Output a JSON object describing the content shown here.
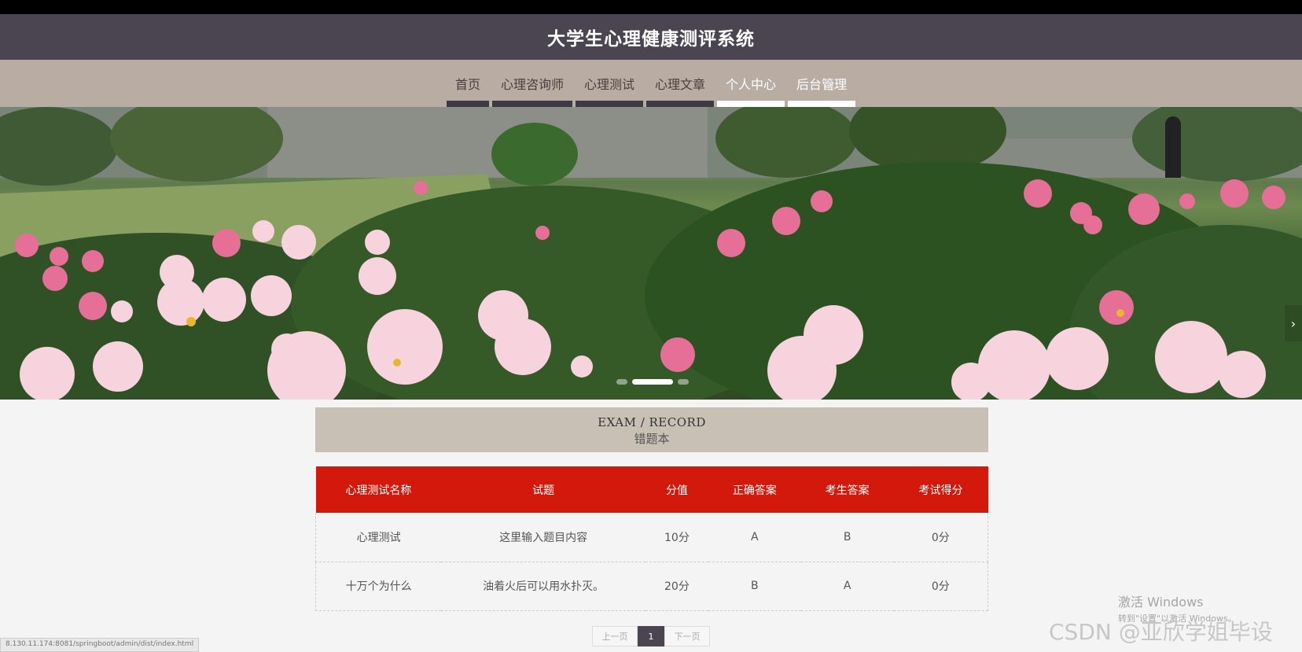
{
  "site": {
    "title": "大学生心理健康测评系统"
  },
  "nav": {
    "items": [
      {
        "label": "首页"
      },
      {
        "label": "心理咨询师"
      },
      {
        "label": "心理测试"
      },
      {
        "label": "心理文章"
      },
      {
        "label": "个人中心"
      },
      {
        "label": "后台管理"
      }
    ]
  },
  "carousel": {
    "next_glyph": "›",
    "active_slide": 2,
    "slide_count": 3
  },
  "section": {
    "title_en": "EXAM / RECORD",
    "title_cn": "错题本"
  },
  "table": {
    "columns": [
      "心理测试名称",
      "试题",
      "分值",
      "正确答案",
      "考生答案",
      "考试得分"
    ],
    "rows": [
      [
        "心理测试",
        "这里输入题目内容",
        "10分",
        "A",
        "B",
        "0分"
      ],
      [
        "十万个为什么",
        "油着火后可以用水扑灭。",
        "20分",
        "B",
        "A",
        "0分"
      ]
    ]
  },
  "pagination": {
    "prev": "上一页",
    "current": "1",
    "next": "下一页"
  },
  "overlay": {
    "windows_activate": "激活 Windows",
    "windows_activate_sub": "转到\"设置\"以激活 Windows。",
    "watermark": "CSDN @亚欣学姐毕设",
    "status_url": "8.130.11.174:8081/springboot/admin/dist/index.html"
  },
  "colors": {
    "header": "#4b4552",
    "nav": "#b8aca3",
    "table_header": "#d2190b",
    "section_head": "#c9c0b5"
  }
}
